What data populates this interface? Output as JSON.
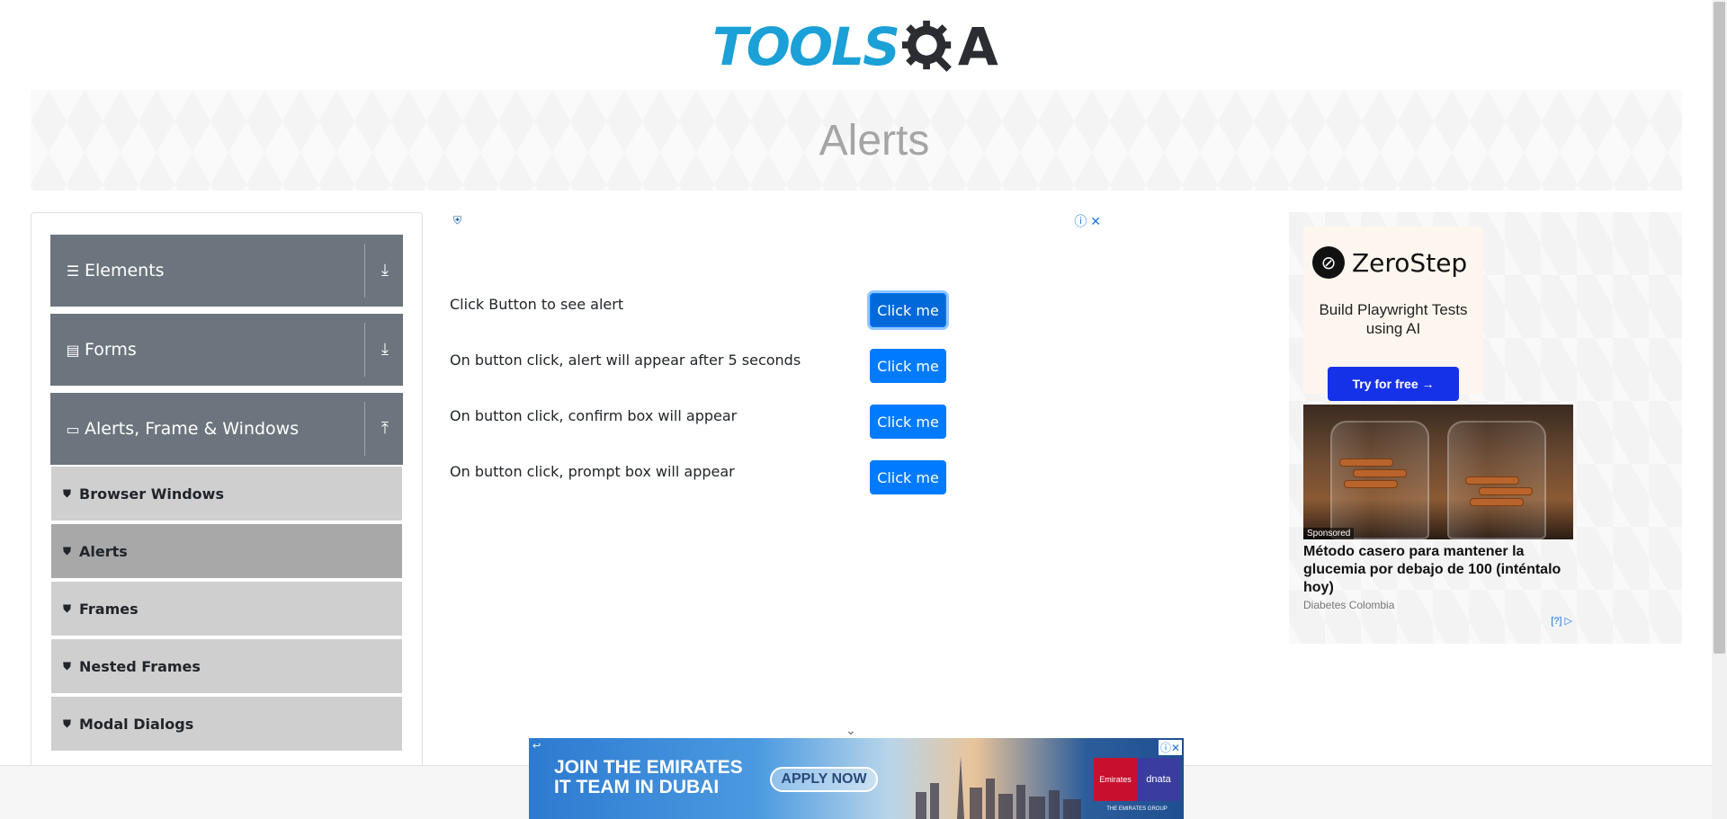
{
  "logo": {
    "text": "TOOLS",
    "suffix": "A"
  },
  "banner": {
    "title": "Alerts"
  },
  "sidebar": {
    "groups": [
      {
        "label": "Elements",
        "icon": "☰",
        "arrow": "⤓"
      },
      {
        "label": "Forms",
        "icon": "▤",
        "arrow": "⤓"
      },
      {
        "label": "Alerts, Frame & Windows",
        "icon": "▭",
        "arrow": "⤒"
      }
    ],
    "subitems": [
      {
        "label": "Browser Windows",
        "active": false
      },
      {
        "label": "Alerts",
        "active": true
      },
      {
        "label": "Frames",
        "active": false
      },
      {
        "label": "Nested Frames",
        "active": false
      },
      {
        "label": "Modal Dialogs",
        "active": false
      }
    ]
  },
  "alerts": [
    {
      "label": "Click Button to see alert",
      "button": "Click me"
    },
    {
      "label": "On button click, alert will appear after 5 seconds",
      "button": "Click me"
    },
    {
      "label": "On button click, confirm box will appear",
      "button": "Click me"
    },
    {
      "label": "On button click, prompt box will appear",
      "button": "Click me"
    }
  ],
  "ad_right": {
    "brand": "ZeroStep",
    "tagline": "Build Playwright Tests using AI",
    "cta": "Try for free →",
    "sponsored": "Sponsored",
    "headline": "Método casero para mantener la glucemia por debajo de 100 (inténtalo hoy)",
    "source": "Diabetes Colombia",
    "adchoice": "[?]"
  },
  "ad_bottom": {
    "headline_1": "JOIN THE EMIRATES",
    "headline_2": "IT TEAM IN DUBAI",
    "cta": "APPLY NOW",
    "brand_1": "Emirates",
    "brand_2": "dnata",
    "group": "THE EMIRATES GROUP"
  },
  "colors": {
    "accent": "#007bff",
    "sidebar_group": "#6c757d",
    "sub_item": "#cfcfcf",
    "sub_active": "#a8a8a8",
    "logo_blue": "#1ba0d7"
  }
}
